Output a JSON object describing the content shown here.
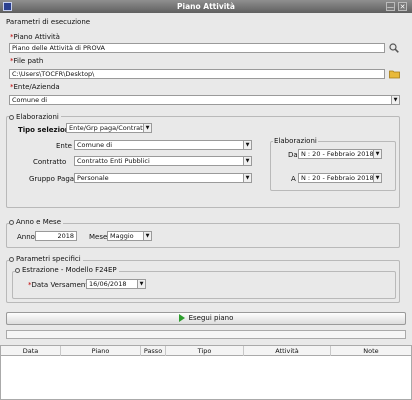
{
  "window": {
    "title": "Piano Attività",
    "minimize": "—",
    "close": "✕"
  },
  "params": {
    "section_title": "Parametri di esecuzione",
    "piano_label": "Piano Attività",
    "piano_value": "Piano delle Attività di PROVA",
    "file_label": "File path",
    "file_value": "C:\\Users\\TOCFR\\Desktop\\",
    "ente_label": "Ente/Azienda",
    "ente_value": "Comune di"
  },
  "elaborazioni": {
    "title": "Elaborazioni",
    "tipo_label": "Tipo selezione",
    "tipo_value": "Ente/Grp paga/Contratto",
    "ente_label": "Ente",
    "ente_value": "Comune di",
    "contratto_label": "Contratto",
    "contratto_value": "Contratto Enti Pubblici",
    "gruppo_label": "Gruppo Paga",
    "gruppo_value": "Personale",
    "range_title": "Elaborazioni",
    "da_label": "Da",
    "da_value": "N : 20 - Febbraio  2018",
    "a_label": "A",
    "a_value": "N : 20 - Febbraio  2018"
  },
  "anno_mese": {
    "title": "Anno e Mese",
    "anno_label": "Anno",
    "anno_value": "2018",
    "mese_label": "Mese",
    "mese_value": "Maggio"
  },
  "specifici": {
    "title": "Parametri specifici",
    "sub_title": "Estrazione - Modello F24EP",
    "data_label": "Data Versamento",
    "data_value": "16/06/2018"
  },
  "run_button": "Esegui piano",
  "table": {
    "columns": [
      "Data",
      "Piano",
      "Passo",
      "Tipo",
      "Attività",
      "Note"
    ],
    "rows": []
  },
  "icons": [
    "search-icon",
    "folder-icon",
    "play-icon",
    "pin-icon",
    "chevron-down-icon"
  ],
  "colors": {
    "titlebar": "#6f6f6f",
    "required": "#c00000",
    "folder": "#e8b93a",
    "play": "#2e9e2e"
  }
}
